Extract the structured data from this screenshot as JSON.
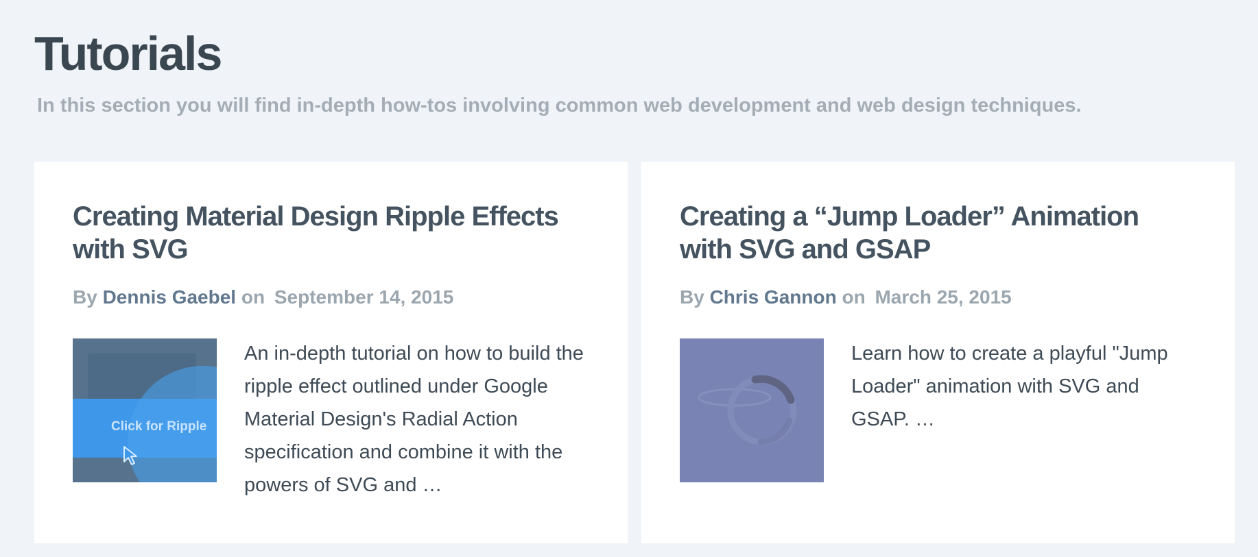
{
  "page": {
    "title": "Tutorials",
    "subtitle": "In this section you will find in-depth how-tos involving common web development and web design techniques."
  },
  "cards": [
    {
      "title": "Creating Material Design Ripple Effects with SVG",
      "by_label": "By",
      "author": "Dennis Gaebel",
      "on_label": "on",
      "date": "September 14, 2015",
      "excerpt": "An in-depth tutorial on how to build the ripple effect outlined under Google Material Design's Radial Action specification and combine it with the powers of SVG and …",
      "thumbnail": {
        "icon": "ripple-effect-thumbnail",
        "caption": "Click for Ripple",
        "background_color": "#56728c",
        "accent_color": "#3f97e9"
      }
    },
    {
      "title": "Creating a “Jump Loader” Animation with SVG and GSAP",
      "by_label": "By",
      "author": "Chris Gannon",
      "on_label": "on",
      "date": "March 25, 2015",
      "excerpt": "Learn how to create a playful \"Jump Loader\" animation with SVG and GSAP. …",
      "thumbnail": {
        "icon": "jump-loader-thumbnail",
        "background_color": "#7a84b4"
      }
    }
  ],
  "colors": {
    "page_background": "#f0f4f8",
    "card_background": "#ffffff",
    "title_text": "#3a4650",
    "muted_text": "#a4adb5",
    "author_link": "#61788e"
  }
}
